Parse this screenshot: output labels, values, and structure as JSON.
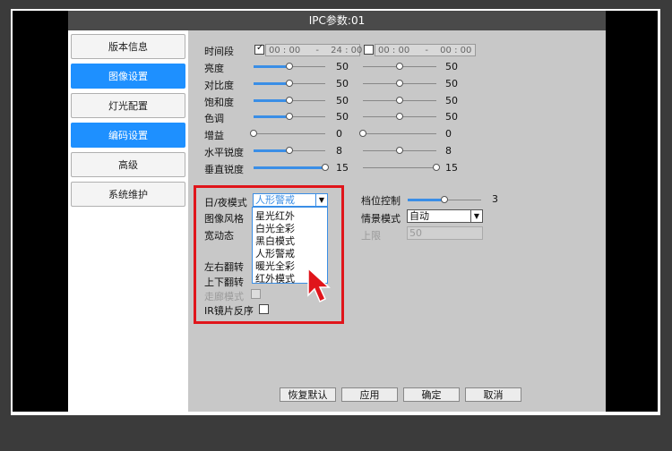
{
  "window": {
    "title": "IPC参数:01"
  },
  "nav": [
    {
      "label": "版本信息"
    },
    {
      "label": "图像设置"
    },
    {
      "label": "灯光配置"
    },
    {
      "label": "编码设置"
    },
    {
      "label": "高级"
    },
    {
      "label": "系统维护"
    }
  ],
  "time_period": {
    "label": "时间段",
    "range1_start": "00 : 00",
    "range1_sep": "-",
    "range1_end": "24 : 00",
    "range2_start": "00 : 00",
    "range2_sep": "-",
    "range2_end": "00 : 00"
  },
  "sliders": [
    {
      "label": "亮度",
      "value1": "50",
      "value2": "50",
      "fraction1": 0.5,
      "fraction2": 0.5
    },
    {
      "label": "对比度",
      "value1": "50",
      "value2": "50",
      "fraction1": 0.5,
      "fraction2": 0.5
    },
    {
      "label": "饱和度",
      "value1": "50",
      "value2": "50",
      "fraction1": 0.5,
      "fraction2": 0.5
    },
    {
      "label": "色调",
      "value1": "50",
      "value2": "50",
      "fraction1": 0.5,
      "fraction2": 0.5
    },
    {
      "label": "增益",
      "value1": "0",
      "value2": "0",
      "fraction1": 0.0,
      "fraction2": 0.0
    },
    {
      "label": "水平锐度",
      "value1": "8",
      "value2": "8",
      "fraction1": 0.5,
      "fraction2": 0.5
    },
    {
      "label": "垂直锐度",
      "value1": "15",
      "value2": "15",
      "fraction1": 1.0,
      "fraction2": 1.0
    }
  ],
  "daynight": {
    "label": "日/夜模式",
    "selected": "人形警戒",
    "options": [
      "星光红外",
      "白光全彩",
      "黑白模式",
      "人形警戒",
      "暖光全彩",
      "红外模式"
    ]
  },
  "left_labels": {
    "image_style": "图像风格",
    "wdr": "宽动态",
    "flip_lr": "左右翻转",
    "flip_ud": "上下翻转",
    "corridor": "走廊模式",
    "ir_reverse": "IR镜片反序"
  },
  "right_panel": {
    "level_label": "档位控制",
    "level_value": "3",
    "level_fraction": 0.5,
    "scene_label": "情景模式",
    "scene_value": "自动",
    "upper_label": "上限",
    "upper_value": "50"
  },
  "buttons": {
    "restore": "恢复默认",
    "apply": "应用",
    "ok": "确定",
    "cancel": "取消"
  },
  "colors": {
    "accent": "#1e90ff",
    "highlight_box": "#e0151b"
  }
}
